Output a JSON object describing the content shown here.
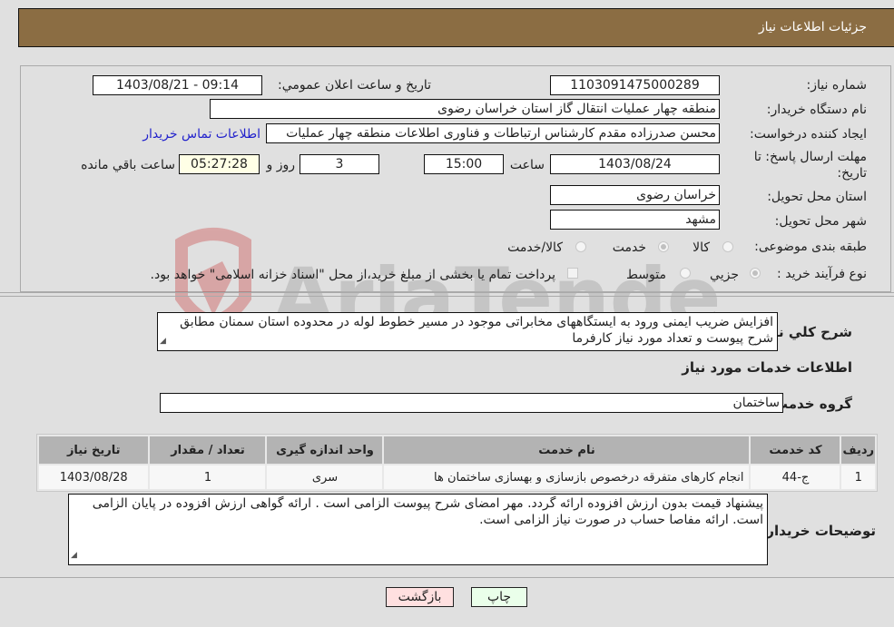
{
  "header": {
    "title": "جزئیات اطلاعات نیاز"
  },
  "form": {
    "need_number": {
      "label": "شماره نیاز:",
      "value": "1103091475000289"
    },
    "announce_datetime": {
      "label": "تاریخ و ساعت اعلان عمومي:",
      "value": "1403/08/21 - 09:14"
    },
    "buyer_org": {
      "label": "نام دستگاه خريدار:",
      "value": "منطقه چهار عملیات انتقال گاز   استان خراسان رضوی"
    },
    "requester": {
      "label": "ايجاد کننده درخواست:",
      "value": "محسن صدرزاده مقدم کارشناس ارتباطات و فناوری اطلاعات منطقه چهار عملیات",
      "contact_link": "اطلاعات تماس خريدار"
    },
    "deadline": {
      "label": "مهلت ارسال پاسخ: تا تاریخ:",
      "date": "1403/08/24",
      "time_label": "ساعت",
      "time": "15:00",
      "days": "3",
      "days_label": "روز و",
      "remaining": "05:27:28",
      "remaining_label": "ساعت باقي مانده"
    },
    "delivery_province": {
      "label": "استان محل تحويل:",
      "value": "خراسان رضوی"
    },
    "delivery_city": {
      "label": "شهر محل تحويل:",
      "value": "مشهد"
    },
    "category": {
      "label": "طبقه بندی موضوعی:",
      "options": [
        "کالا",
        "خدمت",
        "کالا/خدمت"
      ],
      "selected": "خدمت"
    },
    "purchase_type": {
      "label": "نوع فرآيند خريد :",
      "options": [
        "جزيي",
        "متوسط"
      ],
      "selected": "جزيي",
      "treasury_note": "پرداخت تمام يا بخشی از مبلغ خريد،از محل \"اسناد خزانه اسلامی\" خواهد بود."
    }
  },
  "description": {
    "label": "شرح کلي نياز:",
    "value": "افزایش ضریب ایمنی ورود به ایستگاههای مخابراتی موجود در مسیر خطوط لوله در محدوده استان سمنان مطابق شرح پیوست و تعداد مورد نیاز کارفرما"
  },
  "services_section": {
    "title": "اطلاعات خدمات مورد نياز",
    "group_label": "گروه خدمت:",
    "group_value": "ساختمان",
    "table": {
      "headers": [
        "رديف",
        "کد خدمت",
        "نام خدمت",
        "واحد اندازه گيری",
        "تعداد / مقدار",
        "تاريخ نياز"
      ],
      "rows": [
        [
          "1",
          "ج-44",
          "انجام کارهای متفرقه درخصوص بازسازی و بهسازی ساختمان ها",
          "سری",
          "1",
          "1403/08/28"
        ]
      ]
    }
  },
  "buyer_notes": {
    "label": "توضيحات خريدار:",
    "value": "پیشنهاد قیمت بدون ارزش افزوده ارائه گردد. مهر  امضای شرح پیوست الزامی است . ارائه گواهی ارزش افزوده در پایان الزامی است. ارائه مفاصا حساب در صورت نیاز الزامی است."
  },
  "buttons": {
    "print": "چاپ",
    "back": "بازگشت"
  },
  "colors": {
    "header_bg": "#8b6d43",
    "link": "#2222cc",
    "print_bg": "#eaffea",
    "back_bg": "#ffe0e0"
  },
  "watermark": {
    "text": "AriaTender.neT"
  }
}
